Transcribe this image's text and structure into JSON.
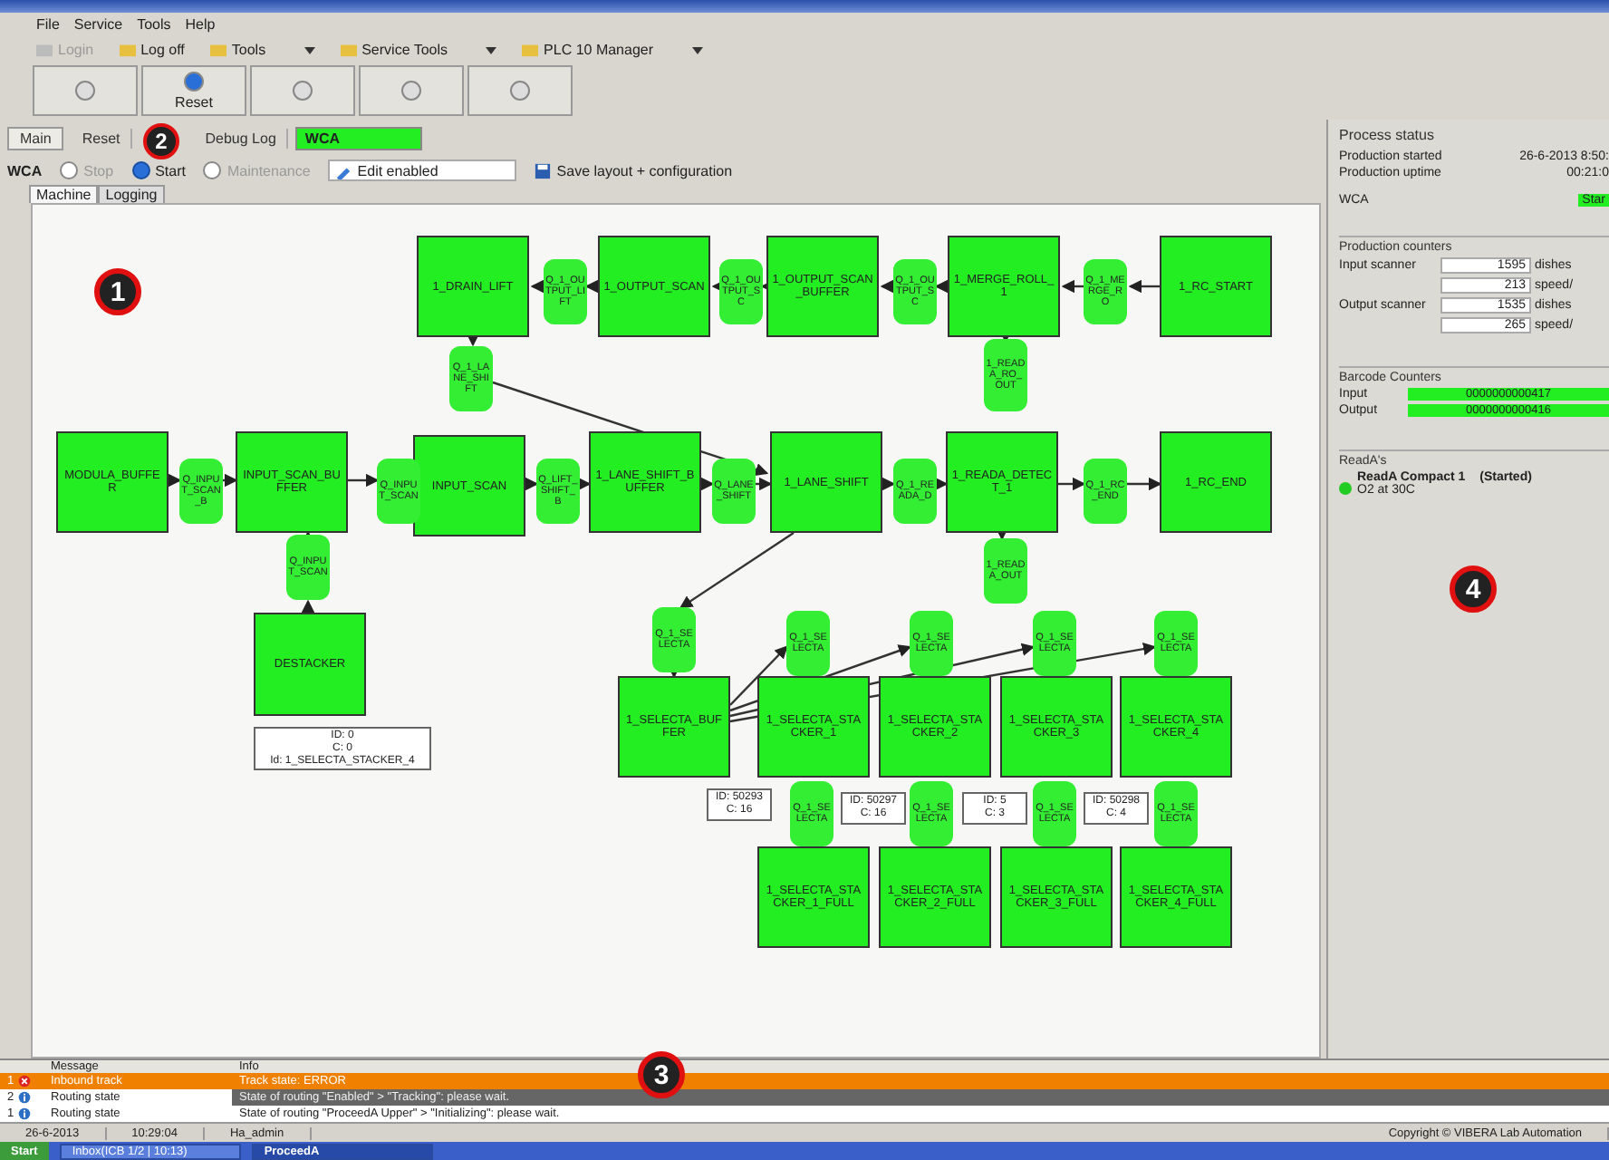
{
  "menu": [
    "File",
    "Service",
    "Tools",
    "Help"
  ],
  "toolbar": [
    {
      "label": "Login",
      "disabled": true,
      "dropdown": false
    },
    {
      "label": "Log off",
      "disabled": false,
      "dropdown": false
    },
    {
      "label": "Tools",
      "disabled": false,
      "dropdown": true
    },
    {
      "label": "Service Tools",
      "disabled": false,
      "dropdown": true
    },
    {
      "label": "PLC 10 Manager",
      "disabled": false,
      "dropdown": true
    }
  ],
  "big_buttons": [
    {
      "disabled": true
    },
    {
      "label": "Reset",
      "disabled": false
    },
    {
      "disabled": true
    },
    {
      "disabled": true
    },
    {
      "disabled": true
    }
  ],
  "view_tabs": [
    {
      "label": "Main",
      "selected": true
    },
    {
      "label": "Reset",
      "selected": false
    },
    {
      "label": "Debug Log",
      "selected": false
    }
  ],
  "status_field": {
    "text": "WCA"
  },
  "mode": {
    "label": "WCA",
    "radios": [
      {
        "label": "Stop",
        "selected": false,
        "disabled": true
      },
      {
        "label": "Start",
        "selected": true,
        "disabled": false
      },
      {
        "label": "Maintenance",
        "selected": false,
        "disabled": true
      }
    ]
  },
  "edit_field": {
    "value": "Edit enabled"
  },
  "save_button": {
    "label": "Save layout + configuration"
  },
  "sub_tabs": [
    {
      "label": "Machine",
      "selected": true
    },
    {
      "label": "Logging",
      "selected": false
    }
  ],
  "diagram": {
    "nodes": [
      {
        "kind": "station",
        "title": "1_DRAIN_LIFT"
      },
      {
        "kind": "station",
        "title": "1_OUTPUT_SCAN"
      },
      {
        "kind": "station",
        "title": "1_OUTPUT_SCAN_BUFFER"
      },
      {
        "kind": "station",
        "title": "1_MERGE_ROLL_1"
      },
      {
        "kind": "station",
        "title": "1_RC_START"
      },
      {
        "kind": "station",
        "title": "MODULA_BUFFER"
      },
      {
        "kind": "station",
        "title": "INPUT_SCAN_BUFFER"
      },
      {
        "kind": "station",
        "title": "INPUT_SCAN"
      },
      {
        "kind": "station",
        "title": "1_LANE_SHIFT_BUFFER"
      },
      {
        "kind": "station",
        "title": "1_LANE_SHIFT"
      },
      {
        "kind": "station",
        "title": "1_READA_DETECT_1"
      },
      {
        "kind": "station",
        "title": "1_RC_END"
      },
      {
        "kind": "station",
        "title": "DESTACKER"
      },
      {
        "kind": "station",
        "title": "1_SELECTA_BUFFER"
      },
      {
        "kind": "station",
        "title": "1_SELECTA_STACKER_1"
      },
      {
        "kind": "station",
        "title": "1_SELECTA_STACKER_2"
      },
      {
        "kind": "station",
        "title": "1_SELECTA_STACKER_3"
      },
      {
        "kind": "station",
        "title": "1_SELECTA_STACKER_4"
      },
      {
        "kind": "station",
        "title": "1_SELECTA_STACKER_1_FULL"
      },
      {
        "kind": "station",
        "title": "1_SELECTA_STACKER_2_FULL"
      },
      {
        "kind": "station",
        "title": "1_SELECTA_STACKER_3_FULL"
      },
      {
        "kind": "station",
        "title": "1_SELECTA_STACKER_4_FULL"
      },
      {
        "kind": "queue",
        "title": "Q_1_OUTPUT_LIFT"
      },
      {
        "kind": "queue",
        "title": "Q_1_OUTPUT_SC"
      },
      {
        "kind": "queue",
        "title": "Q_1_OUTPUT_SC"
      },
      {
        "kind": "queue",
        "title": "Q_1_MERGE_RO"
      },
      {
        "kind": "queue",
        "title": "Q_1_LANE_SHIFT"
      },
      {
        "kind": "queue",
        "title": "1_READA_RO_OUT"
      },
      {
        "kind": "queue",
        "title": "Q_INPUT_SCAN_B"
      },
      {
        "kind": "queue",
        "title": "Q_INPUT_SCAN"
      },
      {
        "kind": "queue",
        "title": "Q_LIFT_SHIFT_B"
      },
      {
        "kind": "queue",
        "title": "Q_LANE_SHIFT"
      },
      {
        "kind": "queue",
        "title": "Q_1_READA_D"
      },
      {
        "kind": "queue",
        "title": "Q_1_RC_END"
      },
      {
        "kind": "queue",
        "title": "Q_INPUT_SCAN"
      },
      {
        "kind": "queue",
        "title": "1_READA_OUT"
      },
      {
        "kind": "queue",
        "title": "Q_1_SELECTA"
      },
      {
        "kind": "queue",
        "title": "Q_1_SELECTA"
      },
      {
        "kind": "queue",
        "title": "Q_1_SELECTA"
      },
      {
        "kind": "queue",
        "title": "Q_1_SELECTA"
      },
      {
        "kind": "queue",
        "title": "Q_1_SELECTA"
      },
      {
        "kind": "queue",
        "title": "Q_1_SELECTA"
      },
      {
        "kind": "queue",
        "title": "Q_1_SELECTA"
      },
      {
        "kind": "queue",
        "title": "Q_1_SELECTA"
      },
      {
        "kind": "queue",
        "title": "Q_1_SELECTA"
      },
      {
        "kind": "info",
        "lines": [
          "ID: 0",
          "C: 0",
          "Id: 1_SELECTA_STACKER_4"
        ]
      },
      {
        "kind": "info",
        "lines": [
          "ID: 50293",
          "C: 16"
        ]
      },
      {
        "kind": "info",
        "lines": [
          "ID: 50297",
          "C: 16"
        ]
      },
      {
        "kind": "info",
        "lines": [
          "ID: 5",
          "C: 3"
        ]
      },
      {
        "kind": "info",
        "lines": [
          "ID: 50298",
          "C: 4"
        ]
      }
    ]
  },
  "process_status": {
    "title": "Process status",
    "rows": [
      {
        "label": "Production started",
        "value": "26-6-2013 8:50:"
      },
      {
        "label": "Production uptime",
        "value": "00:21:0"
      }
    ],
    "wca_label": "WCA",
    "wca_value": "Star"
  },
  "counters": {
    "title": "Production counters",
    "rows": [
      {
        "label": "Input scanner",
        "value": "1595",
        "unit": "dishes"
      },
      {
        "value": "213",
        "unit": "speed/"
      },
      {
        "label": "Output scanner",
        "value": "1535",
        "unit": "dishes"
      },
      {
        "value": "265",
        "unit": "speed/"
      }
    ]
  },
  "barcode": {
    "title": "Barcode Counters",
    "rows": [
      {
        "label": "Input",
        "value": "0000000000417"
      },
      {
        "label": "Output",
        "value": "0000000000416"
      }
    ]
  },
  "readas": {
    "title": "ReadA's",
    "items": [
      {
        "name": "ReadA Compact 1",
        "state": "(Started)",
        "detail": "O2 at 30C"
      }
    ]
  },
  "messages": {
    "columns": [
      "Message",
      "Info"
    ],
    "rows": [
      {
        "index": "1",
        "kind": "error",
        "message": "Inbound track",
        "info": "Track state: ERROR",
        "selected": false
      },
      {
        "index": "2",
        "kind": "info",
        "message": "Routing state",
        "info": "State of routing \"Enabled\" > \"Tracking\": please wait.",
        "selected": true
      },
      {
        "index": "1",
        "kind": "info",
        "message": "Routing state",
        "info": "State of routing \"ProceedA Upper\" > \"Initializing\": please wait.",
        "selected": false
      }
    ]
  },
  "status_bar": {
    "cells": [
      "26-6-2013",
      "10:29:04",
      "Ha_admin"
    ],
    "copyright": "Copyright © VIBERA Lab Automation"
  },
  "taskbar": {
    "start": "Start",
    "tasks": [
      {
        "label": "Inbox(ICB 1/2 | 10:13)",
        "selected": false
      },
      {
        "label": "ProceedA",
        "selected": true
      }
    ]
  },
  "callouts": [
    "1",
    "2",
    "3",
    "4"
  ]
}
